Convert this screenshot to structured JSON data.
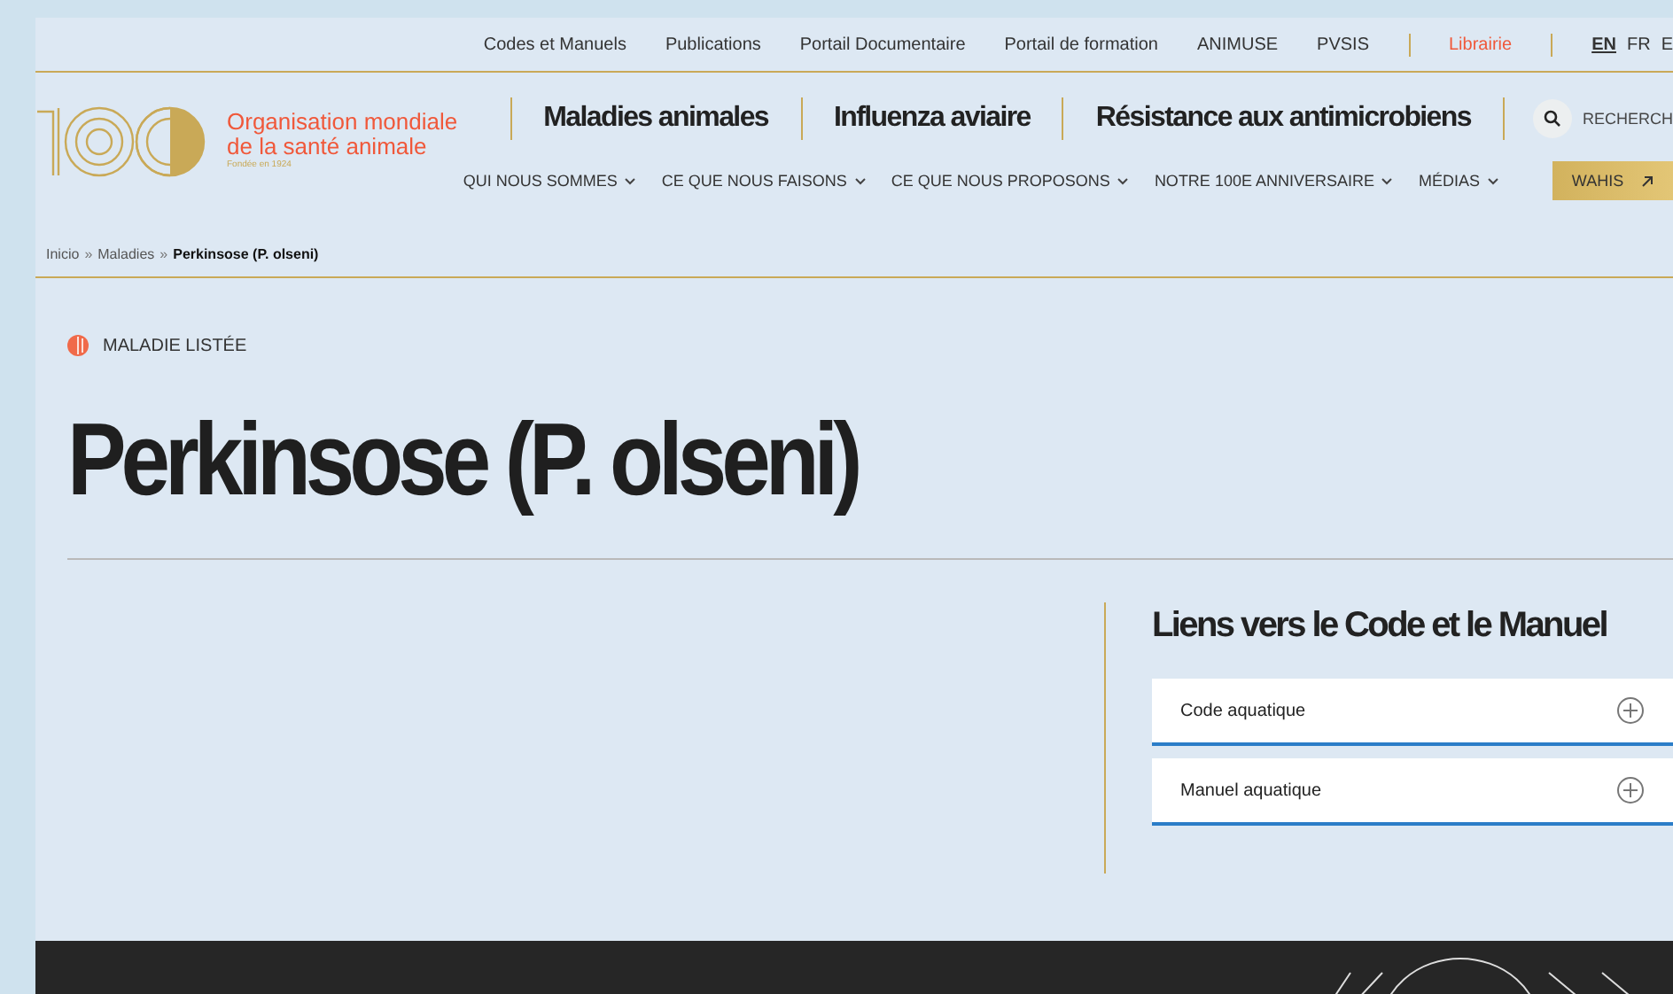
{
  "top_links": [
    {
      "label": "Codes et Manuels",
      "kind": "link"
    },
    {
      "label": "Publications",
      "kind": "link"
    },
    {
      "label": "Portail Documentaire",
      "kind": "link"
    },
    {
      "label": "Portail de formation",
      "kind": "link"
    },
    {
      "label": "ANIMUSE",
      "kind": "link"
    },
    {
      "label": "PVSIS",
      "kind": "link"
    },
    {
      "label": "Librairie",
      "kind": "highlight"
    }
  ],
  "languages": [
    {
      "label": "EN",
      "selected": true
    },
    {
      "label": "FR",
      "selected": false
    },
    {
      "label": "E",
      "selected": false
    }
  ],
  "logo": {
    "name_line_1": "Organisation mondiale",
    "name_line_2": "de la santé animale",
    "founded": "Fondée en 1924"
  },
  "main_links": [
    "Maladies animales",
    "Influenza aviaire",
    "Résistance aux antimicrobiens"
  ],
  "search": {
    "label": "RECHERCH"
  },
  "menus": [
    "QUI NOUS SOMMES",
    "CE QUE NOUS FAISONS",
    "CE QUE NOUS PROPOSONS",
    "NOTRE 100E ANNIVERSAIRE",
    "MÉDIAS"
  ],
  "wahis_button": "WAHIS",
  "breadcrumb_separator": "»",
  "breadcrumb": [
    {
      "label": "Inicio",
      "current": false
    },
    {
      "label": "Maladies",
      "current": false
    },
    {
      "label": "Perkinsose (P. olseni)",
      "current": true
    }
  ],
  "tag": "MALADIE LISTÉE",
  "title": "Perkinsose (P. olseni)",
  "links_section": {
    "heading": "Liens vers le Code et le Manuel",
    "items": [
      {
        "label": "Code aquatique",
        "expanded": false
      },
      {
        "label": "Manuel aquatique",
        "expanded": false
      }
    ]
  }
}
